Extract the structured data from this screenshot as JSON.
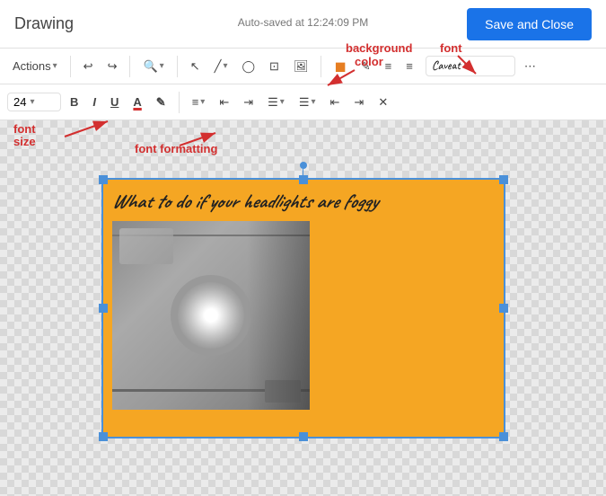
{
  "header": {
    "app_title": "Drawing",
    "autosave_text": "Auto-saved at 12:24:09 PM",
    "save_close_label": "Save and Close"
  },
  "toolbar1": {
    "actions_label": "Actions",
    "actions_arrow": "▾",
    "undo_icon": "↩",
    "redo_icon": "↪",
    "zoom_label": "◉",
    "zoom_arrow": "▾",
    "select_icon": "↖",
    "line_icon": "╱",
    "line_arrow": "▾",
    "shape_icon": "◯",
    "text_icon": "⊞",
    "image_icon": "🖼",
    "bg_color_icon": "◼",
    "border_color_icon": "✎",
    "align_left_icon": "≡",
    "align_center_icon": "≡",
    "font_name": "Caveat",
    "font_arrow": "▾",
    "more_icon": "⋯"
  },
  "toolbar2": {
    "font_size": "24",
    "font_size_arrow": "▾",
    "bold_label": "B",
    "italic_label": "I",
    "underline_label": "U",
    "font_color_icon": "A",
    "highlight_icon": "✎",
    "align_icon": "≡",
    "align_arrow": "▾",
    "indent_decrease": "◁",
    "indent_increase": "▷",
    "list_ordered": "☰",
    "list_ordered_arrow": "▾",
    "list_unordered": "☰",
    "list_unordered_arrow": "▾",
    "indent_less": "⇤",
    "indent_more": "⇥",
    "clear_format": "✖"
  },
  "canvas": {
    "title_text": "What to do if your headlights are foggy"
  },
  "annotations": {
    "font_size_label": "font\nsize",
    "font_formatting_label": "font formatting",
    "background_color_label": "background\ncolor",
    "font_label": "font"
  }
}
